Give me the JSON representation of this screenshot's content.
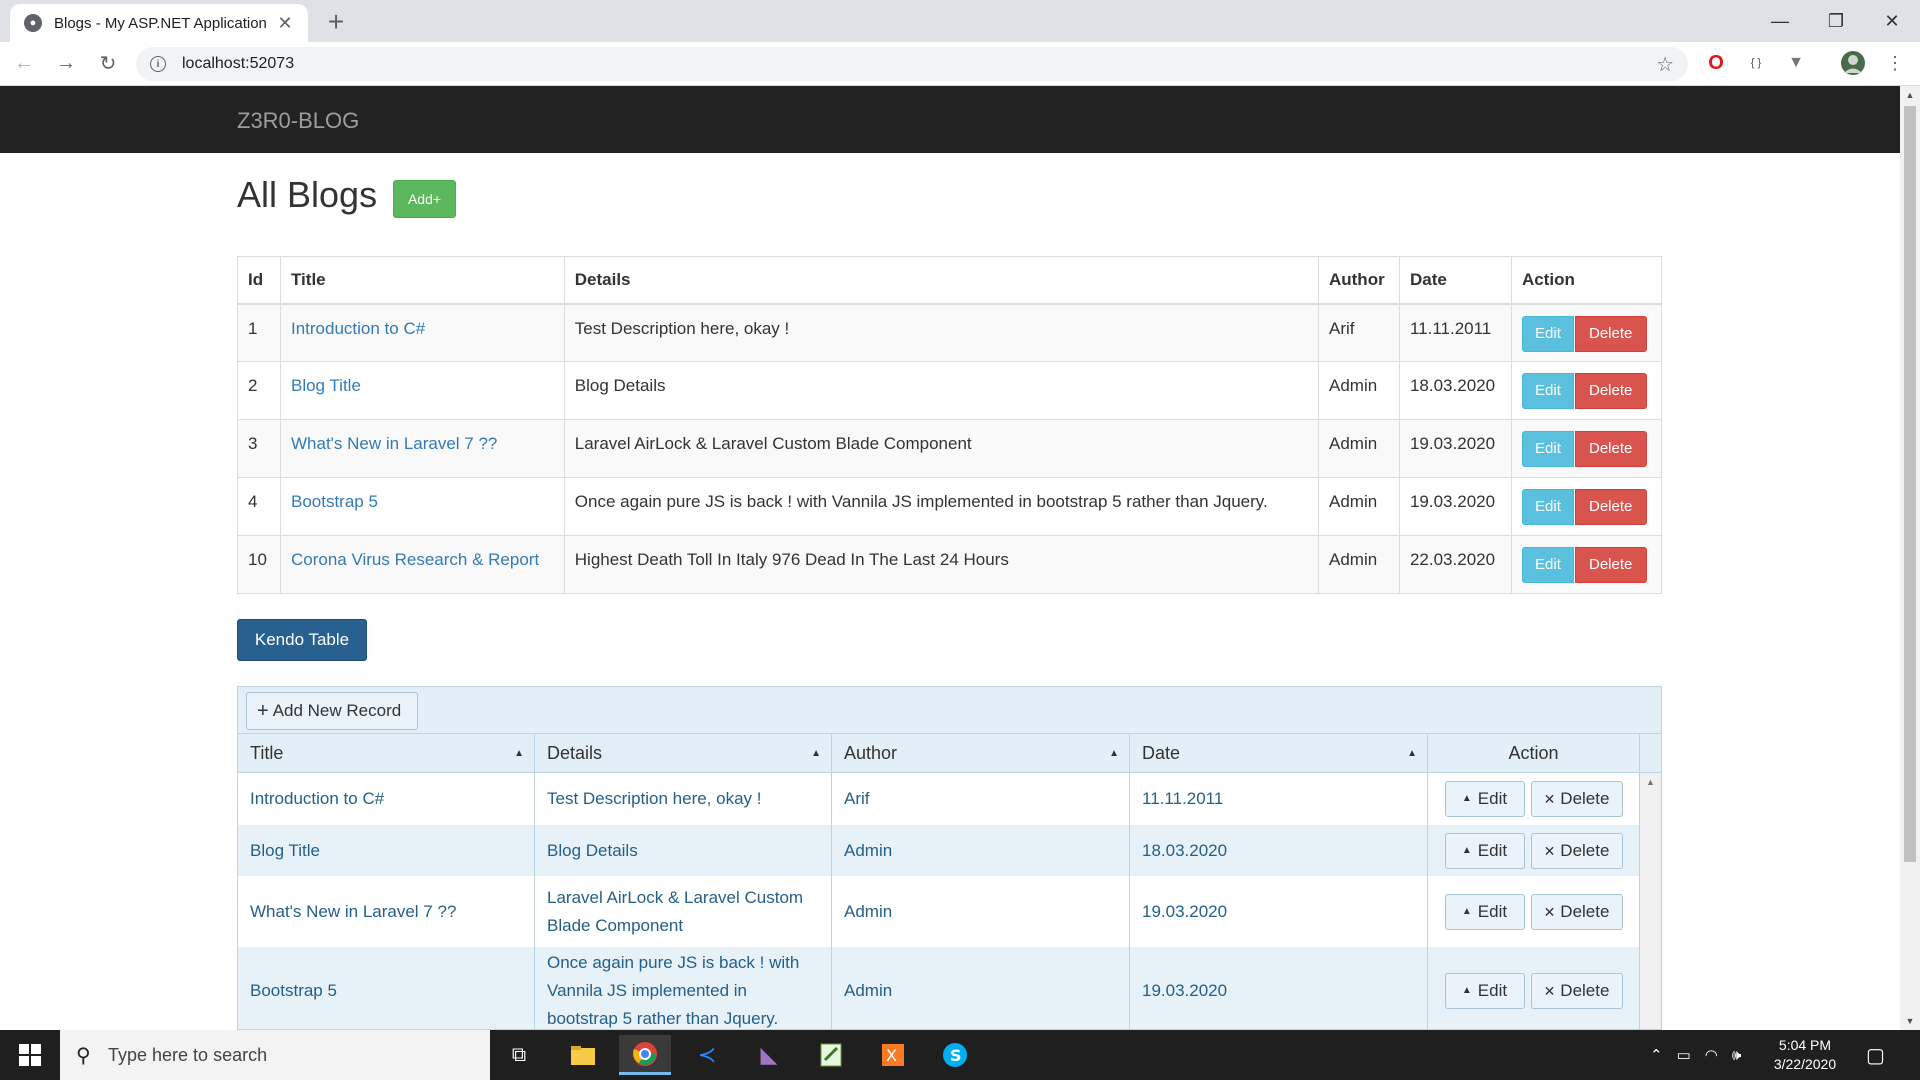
{
  "browser": {
    "tab_title": "Blogs - My ASP.NET Application",
    "url": "localhost:52073"
  },
  "navbar": {
    "brand": "Z3R0-BLOG"
  },
  "page": {
    "heading": "All Blogs",
    "add_button": "Add+"
  },
  "blog_table": {
    "headers": [
      "Id",
      "Title",
      "Details",
      "Author",
      "Date",
      "Action"
    ],
    "rows": [
      {
        "id": "1",
        "title": "Introduction to C#",
        "details": "Test Description here, okay !",
        "author": "Arif",
        "date": "11.11.2011"
      },
      {
        "id": "2",
        "title": "Blog Title",
        "details": "Blog Details",
        "author": "Admin",
        "date": "18.03.2020"
      },
      {
        "id": "3",
        "title": "What's New in Laravel 7 ??",
        "details": "Laravel AirLock & Laravel Custom Blade Component",
        "author": "Admin",
        "date": "19.03.2020"
      },
      {
        "id": "4",
        "title": "Bootstrap 5",
        "details": "Once again pure JS is back ! with Vannila JS implemented in bootstrap 5 rather than Jquery.",
        "author": "Admin",
        "date": "19.03.2020"
      },
      {
        "id": "10",
        "title": "Corona Virus Research & Report",
        "details": "Highest Death Toll In Italy 976 Dead In The Last 24 Hours",
        "author": "Admin",
        "date": "22.03.2020"
      }
    ],
    "edit_label": "Edit",
    "delete_label": "Delete"
  },
  "kendo_button": "Kendo Table",
  "kendo_grid": {
    "add_record_label": "Add New Record",
    "headers": [
      "Title",
      "Details",
      "Author",
      "Date",
      "Action"
    ],
    "rows": [
      {
        "title": "Introduction to C#",
        "details": "Test Description here, okay !",
        "author": "Arif",
        "date": "11.11.2011"
      },
      {
        "title": "Blog Title",
        "details": "Blog Details",
        "author": "Admin",
        "date": "18.03.2020"
      },
      {
        "title": "What's New in Laravel 7 ??",
        "details": "Laravel AirLock & Laravel Custom Blade Component",
        "author": "Admin",
        "date": "19.03.2020"
      },
      {
        "title": "Bootstrap 5",
        "details": "Once again pure JS is back ! with Vannila JS implemented in bootstrap 5 rather than Jquery.",
        "author": "Admin",
        "date": "19.03.2020"
      }
    ],
    "edit_label": "Edit",
    "delete_label": "Delete"
  },
  "taskbar": {
    "search_placeholder": "Type here to search",
    "time": "5:04 PM",
    "date": "3/22/2020"
  },
  "colors": {
    "navbar": "#222222",
    "success": "#5cb85c",
    "info": "#5bc0de",
    "danger": "#d9534f",
    "primary": "#286090",
    "link": "#337ab7"
  }
}
